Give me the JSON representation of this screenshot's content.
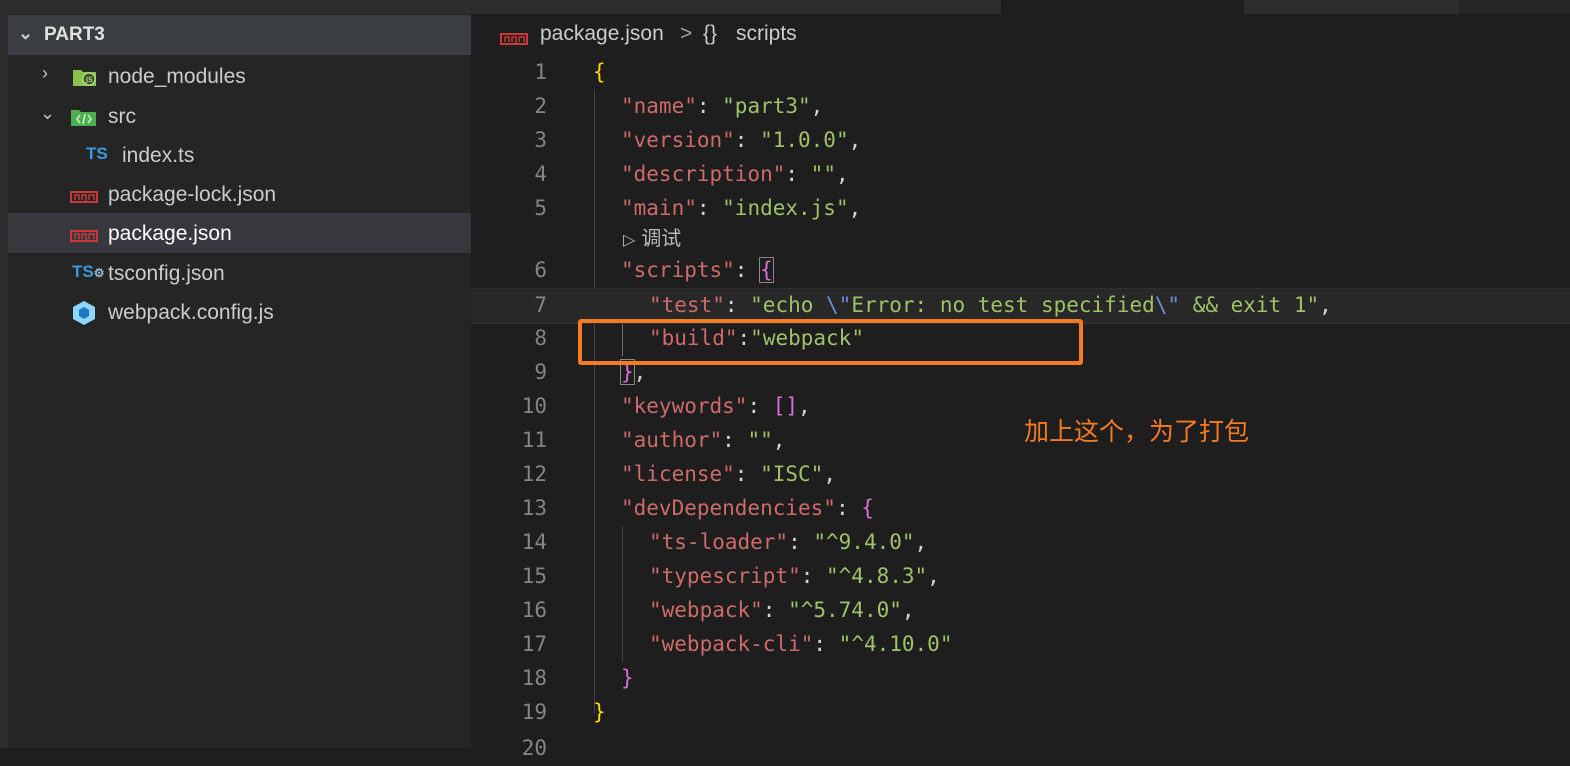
{
  "explorer": {
    "section_title": "PART3",
    "items": [
      {
        "label": "node_modules",
        "twisty": "›"
      },
      {
        "label": "src",
        "twisty": "⌄"
      },
      {
        "label": "index.ts",
        "icon_text": "TS"
      },
      {
        "label": "package-lock.json"
      },
      {
        "label": "package.json"
      },
      {
        "label": "tsconfig.json",
        "icon_text": "TS"
      },
      {
        "label": "webpack.config.js"
      }
    ]
  },
  "breadcrumb": {
    "file": "package.json",
    "separator": ">",
    "symbol_icon": "{}",
    "symbol": "scripts"
  },
  "editor": {
    "codelens_label": "调试",
    "line_numbers": [
      "1",
      "2",
      "3",
      "4",
      "5",
      "6",
      "7",
      "8",
      "9",
      "10",
      "11",
      "12",
      "13",
      "14",
      "15",
      "16",
      "17",
      "18",
      "19",
      "20"
    ],
    "lines": {
      "l2_key": "\"name\"",
      "l2_val": "\"part3\"",
      "l3_key": "\"version\"",
      "l3_val": "\"1.0.0\"",
      "l4_key": "\"description\"",
      "l4_val": "\"\"",
      "l5_key": "\"main\"",
      "l5_val": "\"index.js\"",
      "l6_key": "\"scripts\"",
      "l7_key": "\"test\"",
      "l7_val_a": "\"echo ",
      "l7_esc1": "\\\"",
      "l7_val_b": "Error: no test specified",
      "l7_esc2": "\\\"",
      "l7_val_c": " && exit 1\"",
      "l8_key": "\"build\"",
      "l8_val": "\"webpack\"",
      "l10_key": "\"keywords\"",
      "l11_key": "\"author\"",
      "l11_val": "\"\"",
      "l12_key": "\"license\"",
      "l12_val": "\"ISC\"",
      "l13_key": "\"devDependencies\"",
      "l14_key": "\"ts-loader\"",
      "l14_val": "\"^9.4.0\"",
      "l15_key": "\"typescript\"",
      "l15_val": "\"^4.8.3\"",
      "l16_key": "\"webpack\"",
      "l16_val": "\"^5.74.0\"",
      "l17_key": "\"webpack-cli\"",
      "l17_val": "\"^4.10.0\""
    }
  },
  "annotation": {
    "text": "加上这个，为了打包",
    "color": "#f47b20"
  },
  "colors": {
    "editor_bg": "#1e1e1e",
    "sidebar_bg": "#252526",
    "json_key": "#ce6a6a",
    "json_string": "#9fc167",
    "bracket_level1": "#ffd700",
    "bracket_level2": "#da70d6",
    "line_number": "#858585"
  },
  "icons": {
    "node_modules": "folder-node-icon",
    "src": "folder-src-icon",
    "index_ts": "typescript-icon",
    "package_lock": "npm-icon",
    "package_json": "npm-icon",
    "tsconfig": "tsconfig-icon",
    "webpack_config": "webpack-icon"
  }
}
